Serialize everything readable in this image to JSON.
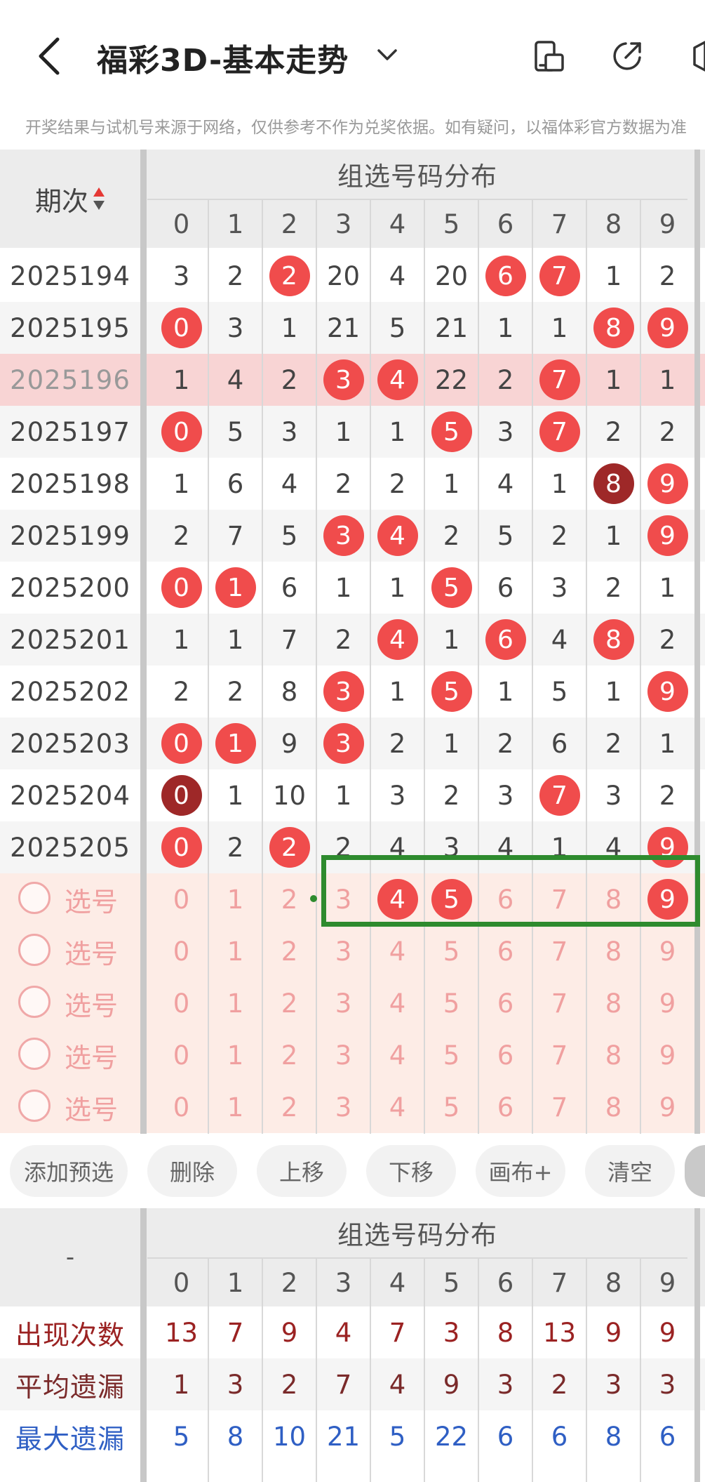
{
  "header": {
    "title": "福彩3D-基本走势",
    "notice": "开奖结果与试机号来源于网络，仅供参考不作为兑奖依据。如有疑问，以福体彩官方数据为准"
  },
  "table": {
    "period_label": "期次",
    "group_title": "组选号码分布",
    "digits": [
      "0",
      "1",
      "2",
      "3",
      "4",
      "5",
      "6",
      "7",
      "8",
      "9"
    ],
    "rows": [
      {
        "period": "2025194",
        "cells": [
          "3",
          "2",
          "2",
          "20",
          "4",
          "20",
          "6",
          "7",
          "1",
          "2"
        ],
        "balls": [
          2,
          6,
          7
        ],
        "dark": [],
        "highlight": false
      },
      {
        "period": "2025195",
        "cells": [
          "0",
          "3",
          "1",
          "21",
          "5",
          "21",
          "1",
          "1",
          "8",
          "9"
        ],
        "balls": [
          0,
          8,
          9
        ],
        "dark": [],
        "highlight": false
      },
      {
        "period": "2025196",
        "cells": [
          "1",
          "4",
          "2",
          "3",
          "4",
          "22",
          "2",
          "7",
          "1",
          "1"
        ],
        "balls": [
          3,
          4,
          7
        ],
        "dark": [],
        "highlight": true
      },
      {
        "period": "2025197",
        "cells": [
          "0",
          "5",
          "3",
          "1",
          "1",
          "5",
          "3",
          "7",
          "2",
          "2"
        ],
        "balls": [
          0,
          5,
          7
        ],
        "dark": [],
        "highlight": false
      },
      {
        "period": "2025198",
        "cells": [
          "1",
          "6",
          "4",
          "2",
          "2",
          "1",
          "4",
          "1",
          "8",
          "9"
        ],
        "balls": [
          8,
          9
        ],
        "dark": [
          8
        ],
        "highlight": false
      },
      {
        "period": "2025199",
        "cells": [
          "2",
          "7",
          "5",
          "3",
          "4",
          "2",
          "5",
          "2",
          "1",
          "9"
        ],
        "balls": [
          3,
          4,
          9
        ],
        "dark": [],
        "highlight": false
      },
      {
        "period": "2025200",
        "cells": [
          "0",
          "1",
          "6",
          "1",
          "1",
          "5",
          "6",
          "3",
          "2",
          "1"
        ],
        "balls": [
          0,
          1,
          5
        ],
        "dark": [],
        "highlight": false
      },
      {
        "period": "2025201",
        "cells": [
          "1",
          "1",
          "7",
          "2",
          "4",
          "1",
          "6",
          "4",
          "8",
          "2"
        ],
        "balls": [
          4,
          6,
          8
        ],
        "dark": [],
        "highlight": false
      },
      {
        "period": "2025202",
        "cells": [
          "2",
          "2",
          "8",
          "3",
          "1",
          "5",
          "1",
          "5",
          "1",
          "9"
        ],
        "balls": [
          3,
          5,
          9
        ],
        "dark": [],
        "highlight": false
      },
      {
        "period": "2025203",
        "cells": [
          "0",
          "1",
          "9",
          "3",
          "2",
          "1",
          "2",
          "6",
          "2",
          "1"
        ],
        "balls": [
          0,
          1,
          3
        ],
        "dark": [],
        "highlight": false
      },
      {
        "period": "2025204",
        "cells": [
          "0",
          "1",
          "10",
          "1",
          "3",
          "2",
          "3",
          "7",
          "3",
          "2"
        ],
        "balls": [
          0,
          7
        ],
        "dark": [
          0
        ],
        "highlight": false
      },
      {
        "period": "2025205",
        "cells": [
          "0",
          "2",
          "2",
          "2",
          "4",
          "3",
          "4",
          "1",
          "4",
          "9"
        ],
        "balls": [
          0,
          2,
          9
        ],
        "dark": [],
        "highlight": false
      }
    ],
    "select_label": "选号",
    "select_rows": [
      {
        "selected": [
          4,
          5,
          9
        ]
      },
      {
        "selected": []
      },
      {
        "selected": []
      },
      {
        "selected": []
      },
      {
        "selected": []
      }
    ]
  },
  "toolbar": {
    "add": "添加预选",
    "delete": "删除",
    "up": "上移",
    "down": "下移",
    "canvas": "画布+",
    "clear": "清空"
  },
  "stats": {
    "corner": "-",
    "group_title": "组选号码分布",
    "rows": [
      {
        "label": "出现次数",
        "values": [
          "13",
          "7",
          "9",
          "4",
          "7",
          "3",
          "8",
          "13",
          "9",
          "9"
        ],
        "color": "#9b2222"
      },
      {
        "label": "平均遗漏",
        "values": [
          "1",
          "3",
          "2",
          "7",
          "4",
          "9",
          "3",
          "2",
          "3",
          "3"
        ],
        "color": "#7a2a2a"
      },
      {
        "label": "最大遗漏",
        "values": [
          "5",
          "8",
          "10",
          "21",
          "5",
          "22",
          "6",
          "6",
          "8",
          "6"
        ],
        "color": "#2f5fc4"
      }
    ]
  },
  "colors": {
    "ball_red": "#f04c4c",
    "ball_dark": "#9e2828",
    "select_bg": "#fdece6",
    "select_digit": "#f0a0a0",
    "highlight_row": "#f8d4d4",
    "frame_green": "#2e8b2e"
  }
}
